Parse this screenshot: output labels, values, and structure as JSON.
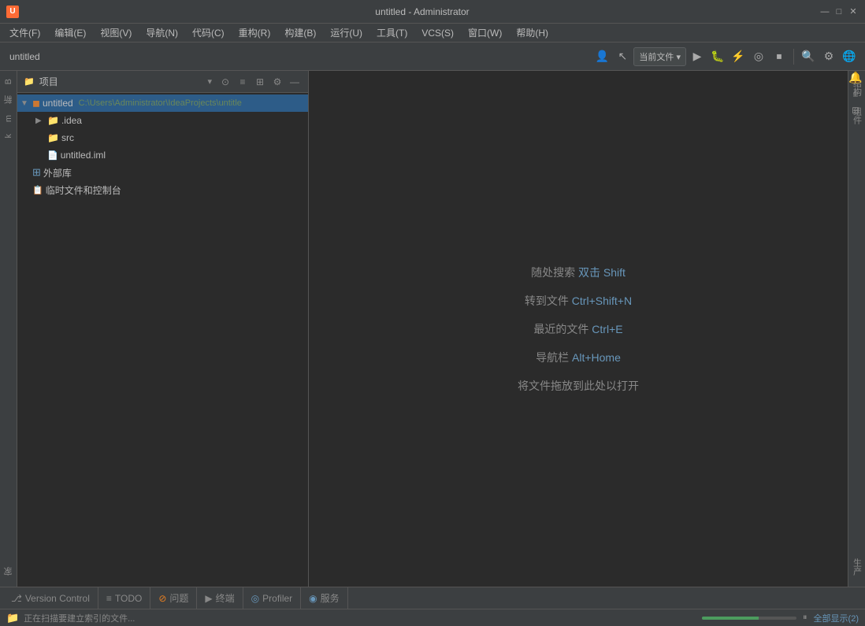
{
  "titleBar": {
    "appIcon": "U",
    "title": "untitled - Administrator",
    "minimize": "—",
    "maximize": "□",
    "close": "✕"
  },
  "menuBar": {
    "items": [
      {
        "label": "文件(F)"
      },
      {
        "label": "编辑(E)"
      },
      {
        "label": "视图(V)"
      },
      {
        "label": "导航(N)"
      },
      {
        "label": "代码(C)"
      },
      {
        "label": "重构(R)"
      },
      {
        "label": "构建(B)"
      },
      {
        "label": "运行(U)"
      },
      {
        "label": "工具(T)"
      },
      {
        "label": "VCS(S)"
      },
      {
        "label": "窗口(W)"
      },
      {
        "label": "帮助(H)"
      }
    ]
  },
  "toolbar": {
    "tabName": "untitled",
    "dropdown": "当前文件 ▾",
    "icons": [
      "▶",
      "⏸",
      "↺",
      "⏩",
      "⏹",
      "🔍",
      "⚙",
      "🌐"
    ]
  },
  "filePanel": {
    "title": "项目",
    "projectName": "untitled",
    "projectPath": "C:\\Users\\Administrator\\IdeaProjects\\untitle",
    "items": [
      {
        "type": "folder",
        "name": ".idea",
        "indent": 1,
        "hasArrow": true,
        "collapsed": true
      },
      {
        "type": "folder",
        "name": "src",
        "indent": 1,
        "hasArrow": false
      },
      {
        "type": "file",
        "name": "untitled.iml",
        "indent": 1,
        "hasArrow": false
      },
      {
        "type": "library",
        "name": "外部库",
        "indent": 0,
        "hasArrow": false
      },
      {
        "type": "temp",
        "name": "临时文件和控制台",
        "indent": 0,
        "hasArrow": false
      }
    ]
  },
  "editorHints": [
    {
      "text": "随处搜索",
      "shortcut": " 双击 Shift"
    },
    {
      "text": "转到文件",
      "shortcut": " Ctrl+Shift+N"
    },
    {
      "text": "最近的文件",
      "shortcut": " Ctrl+E"
    },
    {
      "text": "导航栏",
      "shortcut": " Alt+Home"
    },
    {
      "text": "将文件拖放到此处以打开",
      "shortcut": ""
    }
  ],
  "leftSideTabs": [
    {
      "label": "B"
    },
    {
      "label": "新"
    },
    {
      "label": "m"
    },
    {
      "label": "k"
    },
    {
      "label": "家"
    }
  ],
  "rightSideTabs": [
    {
      "label": "结构"
    },
    {
      "label": "组件"
    },
    {
      "label": "生产"
    }
  ],
  "bottomTabs": [
    {
      "icon": "⎇",
      "label": "Version Control"
    },
    {
      "icon": "≡",
      "label": "TODO"
    },
    {
      "icon": "⚠",
      "label": "问题"
    },
    {
      "icon": "▶",
      "label": "终端"
    },
    {
      "icon": "◎",
      "label": "Profiler"
    },
    {
      "icon": "◉",
      "label": "服务"
    }
  ],
  "statusBar": {
    "text": "正在扫描要建立索引的文件...",
    "progressWidth": "60%",
    "pauseIcon": "⏸",
    "showAll": "全部显示(2)"
  }
}
